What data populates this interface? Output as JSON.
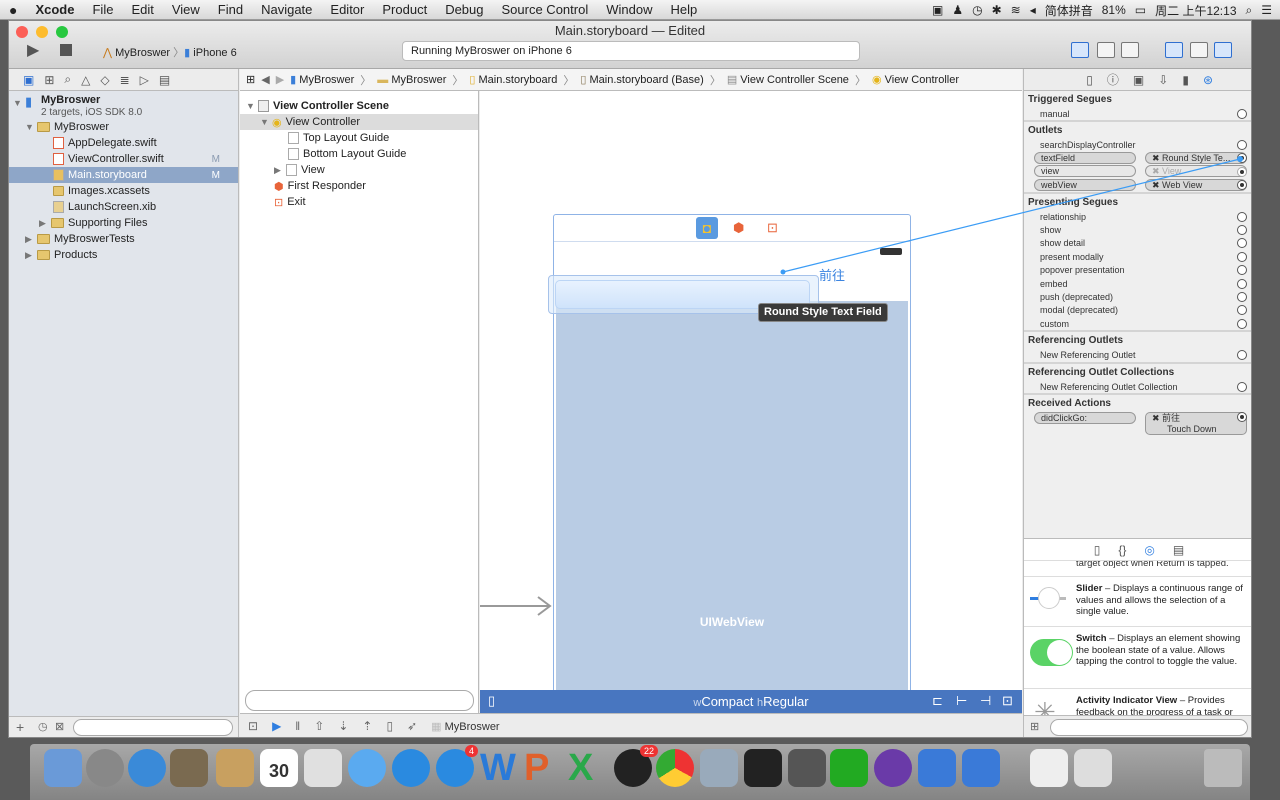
{
  "menubar": {
    "apple": "",
    "items": [
      "Xcode",
      "File",
      "Edit",
      "View",
      "Find",
      "Navigate",
      "Editor",
      "Product",
      "Debug",
      "Source Control",
      "Window",
      "Help"
    ],
    "input_method": "简体拼音",
    "battery": "81%",
    "clock": "周二 上午12:13"
  },
  "window": {
    "title": "Main.storyboard — Edited",
    "scheme": "MyBroswer",
    "device": "iPhone 6",
    "activity": "Running MyBroswer on iPhone 6"
  },
  "jumpbar": [
    "MyBroswer",
    "MyBroswer",
    "Main.storyboard",
    "Main.storyboard (Base)",
    "View Controller Scene",
    "View Controller"
  ],
  "navigator": {
    "project": "MyBroswer",
    "project_sub": "2 targets, iOS SDK 8.0",
    "items": [
      {
        "label": "MyBroswer",
        "type": "folder",
        "level": 1,
        "open": true
      },
      {
        "label": "AppDelegate.swift",
        "type": "swift",
        "level": 2
      },
      {
        "label": "ViewController.swift",
        "type": "swift",
        "level": 2,
        "badge": "M"
      },
      {
        "label": "Main.storyboard",
        "type": "storyboard",
        "level": 2,
        "badge": "M",
        "selected": true
      },
      {
        "label": "Images.xcassets",
        "type": "assets",
        "level": 2
      },
      {
        "label": "LaunchScreen.xib",
        "type": "xib",
        "level": 2
      },
      {
        "label": "Supporting Files",
        "type": "folder",
        "level": 2,
        "closed": true
      },
      {
        "label": "MyBroswerTests",
        "type": "folder",
        "level": 1,
        "closed": true
      },
      {
        "label": "Products",
        "type": "folder",
        "level": 1,
        "closed": true
      }
    ]
  },
  "outline": {
    "scene": "View Controller Scene",
    "items": [
      {
        "label": "View Controller",
        "level": 1,
        "selected": true
      },
      {
        "label": "Top Layout Guide",
        "level": 2
      },
      {
        "label": "Bottom Layout Guide",
        "level": 2
      },
      {
        "label": "View",
        "level": 2
      },
      {
        "label": "First Responder",
        "level": 1
      },
      {
        "label": "Exit",
        "level": 1
      }
    ]
  },
  "canvas": {
    "button_label": "前往",
    "tooltip": "Round Style Text Field",
    "webview_label": "UIWebView",
    "size_w": "w",
    "size_w_val": "Compact",
    "size_h": "h",
    "size_h_val": "Regular"
  },
  "debugbar": {
    "target": "MyBroswer"
  },
  "inspector": {
    "triggered": {
      "title": "Triggered Segues",
      "items": [
        "manual"
      ]
    },
    "outlets": {
      "title": "Outlets",
      "items": [
        {
          "name": "searchDisplayController"
        },
        {
          "name": "textField",
          "target": "Round Style Te..."
        },
        {
          "name": "view",
          "target": "View",
          "dim": true
        },
        {
          "name": "webView",
          "target": "Web View"
        }
      ]
    },
    "presenting": {
      "title": "Presenting Segues",
      "items": [
        "relationship",
        "show",
        "show detail",
        "present modally",
        "popover presentation",
        "embed",
        "push (deprecated)",
        "modal (deprecated)",
        "custom"
      ]
    },
    "ref_outlets": {
      "title": "Referencing Outlets",
      "items": [
        "New Referencing Outlet"
      ]
    },
    "ref_collections": {
      "title": "Referencing Outlet Collections",
      "items": [
        "New Referencing Outlet Collection"
      ]
    },
    "actions": {
      "title": "Received Actions",
      "name": "didClickGo:",
      "target": "前往",
      "event": "Touch Down"
    }
  },
  "library": {
    "cut_text": "target object when Return is tapped.",
    "items": [
      {
        "title": "Slider",
        "desc": " – Displays a continuous range of values and allows the selection of a single value."
      },
      {
        "title": "Switch",
        "desc": " – Displays an element showing the boolean state of a value. Allows tapping the control to toggle the value."
      },
      {
        "title": "Activity Indicator View",
        "desc": " – Provides feedback on the progress of a task or process of unknown duration."
      }
    ]
  },
  "dock": {
    "calendar_day": "30",
    "appstore_badge": "4",
    "qq_badge": "22"
  },
  "colors": {
    "accent": "#3b84e0",
    "canvas_bar": "#4876c0",
    "webview": "#b9cce4",
    "selection": "#8ea6c8"
  }
}
